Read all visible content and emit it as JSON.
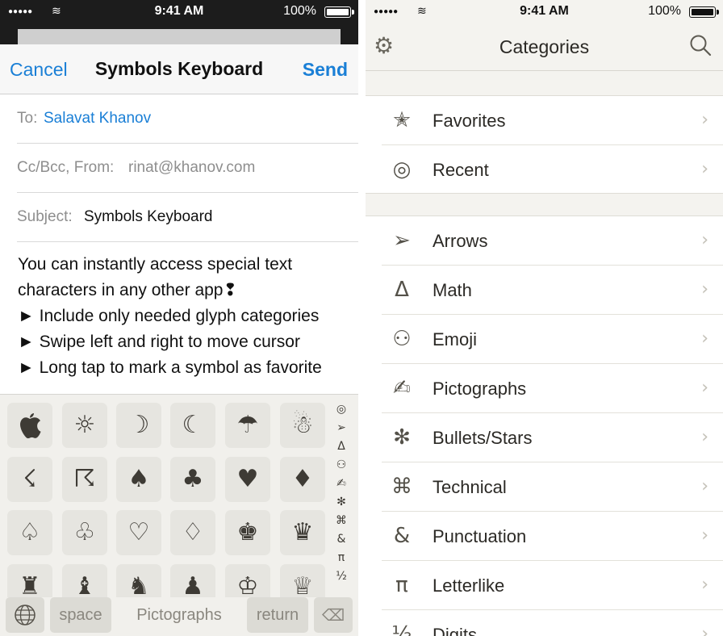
{
  "status": {
    "time": "9:41 AM",
    "battery": "100%"
  },
  "mail": {
    "cancel": "Cancel",
    "title": "Symbols Keyboard",
    "send": "Send",
    "to_label": "To:",
    "to_value": "Salavat Khanov",
    "ccbcc_label": "Cc/Bcc, From:",
    "ccbcc_value": "rinat@khanov.com",
    "subject_label": "Subject:",
    "subject_value": "Symbols Keyboard",
    "body": [
      "You can instantly access special text",
      "characters in any other app❢",
      "► Include only needed glyph categories",
      "► Swipe left and right to move cursor",
      "► Long tap to mark a symbol as favorite"
    ]
  },
  "keyboard": {
    "keys": [
      [
        "",
        "☼",
        "☽",
        "☾",
        "☂",
        "☃"
      ],
      [
        "☇",
        "☈",
        "♠",
        "♣",
        "♥",
        "♦"
      ],
      [
        "♤",
        "♧",
        "♡",
        "♢",
        "♚",
        "♛"
      ],
      [
        "♜",
        "♝",
        "♞",
        "♟",
        "♔",
        "♕"
      ]
    ],
    "side_categories": [
      "◎",
      "➢",
      "Δ",
      "⚇",
      "✍",
      "✻",
      "⌘",
      "&",
      "π",
      "½"
    ],
    "globe": "🌐",
    "space": "space",
    "current_category": "Pictographs",
    "return": "return",
    "delete": "⌫"
  },
  "categories": {
    "title": "Categories",
    "group1": [
      {
        "icon": "✭",
        "label": "Favorites"
      },
      {
        "icon": "◎",
        "label": "Recent"
      }
    ],
    "group2": [
      {
        "icon": "➢",
        "label": "Arrows"
      },
      {
        "icon": "Δ",
        "label": "Math"
      },
      {
        "icon": "⚇",
        "label": "Emoji"
      },
      {
        "icon": "✍",
        "label": "Pictographs"
      },
      {
        "icon": "✻",
        "label": "Bullets/Stars"
      },
      {
        "icon": "⌘",
        "label": "Technical"
      },
      {
        "icon": "&",
        "label": "Punctuation"
      },
      {
        "icon": "π",
        "label": "Letterlike"
      },
      {
        "icon": "½",
        "label": "Digits"
      }
    ]
  }
}
